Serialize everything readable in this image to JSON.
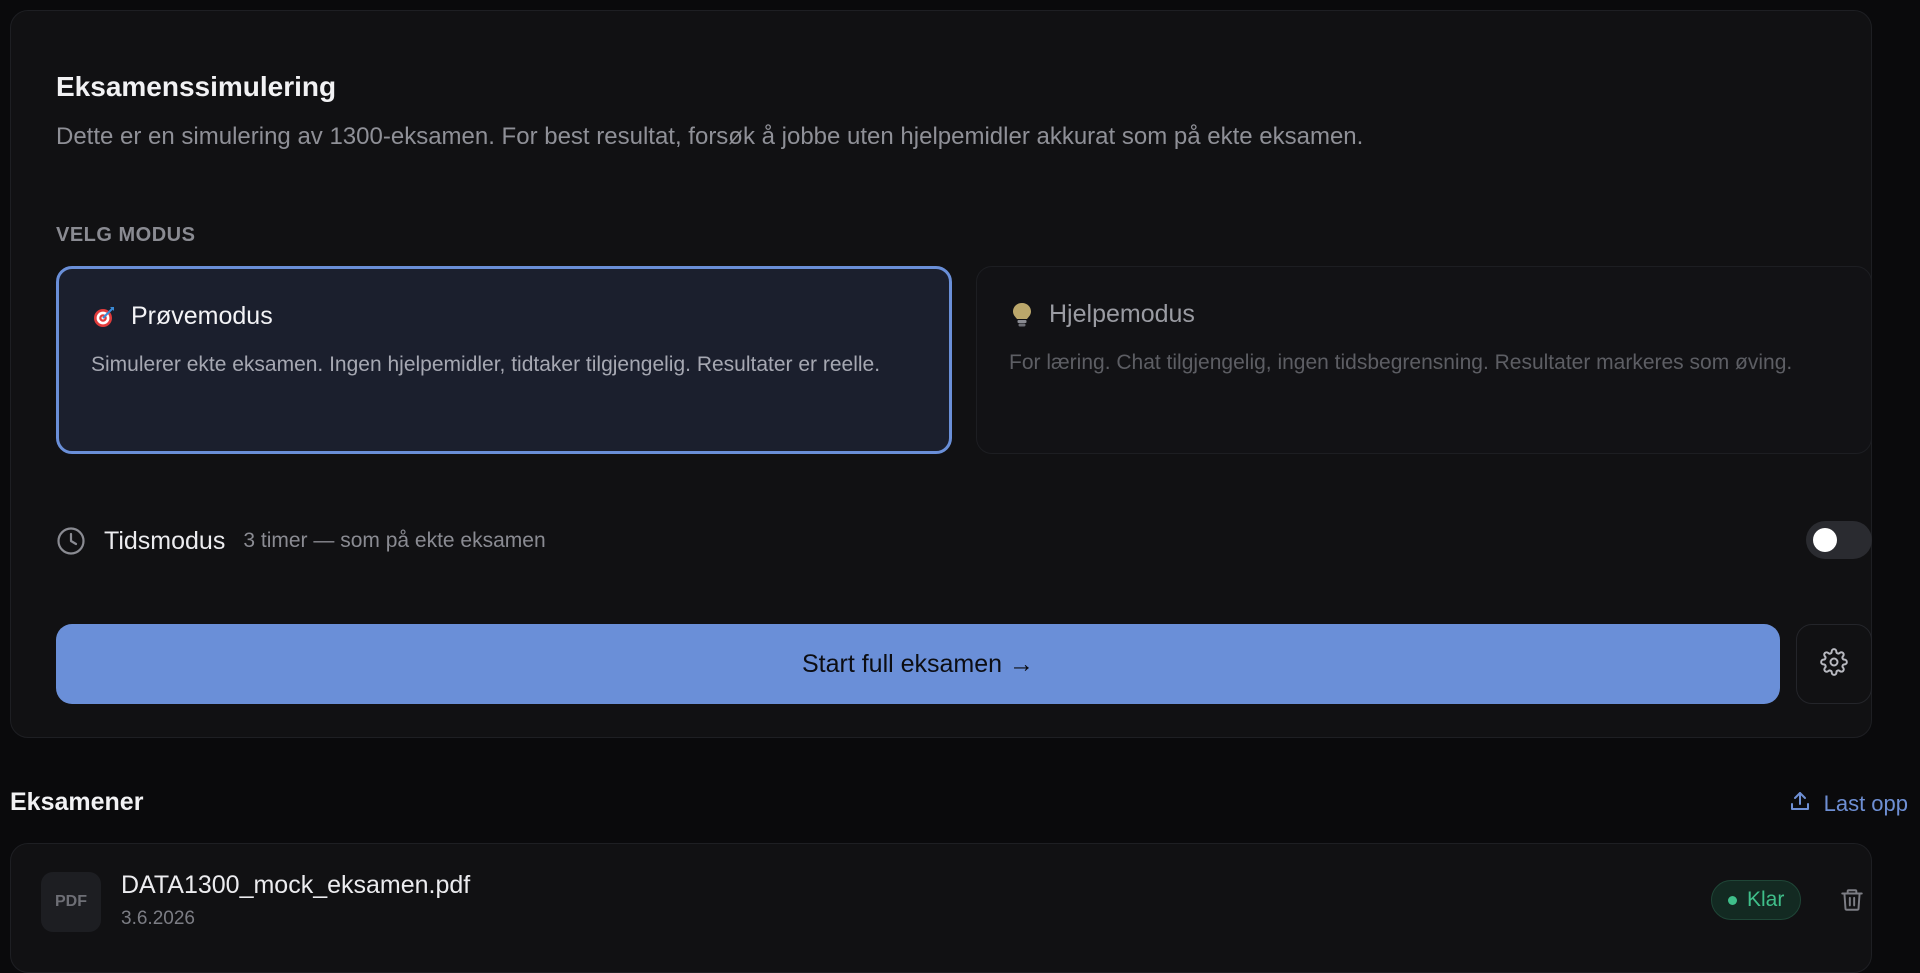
{
  "exam_sim": {
    "title": "Eksamenssimulering",
    "subtitle": "Dette er en simulering av 1300-eksamen. For best resultat, forsøk å jobbe uten hjelpemidler akkurat som på ekte eksamen.",
    "mode_label": "VELG MODUS",
    "modes": [
      {
        "icon": "target-icon",
        "title": "Prøvemodus",
        "description": "Simulerer ekte eksamen. Ingen hjelpemidler, tidtaker tilgjengelig. Resultater er reelle.",
        "selected": true
      },
      {
        "icon": "lightbulb-icon",
        "title": "Hjelpemodus",
        "description": "For læring. Chat tilgjengelig, ingen tidsbegrensning. Resultater markeres som øving.",
        "selected": false
      }
    ],
    "time_mode": {
      "icon": "clock-icon",
      "label": "Tidsmodus",
      "description": "3 timer — som på ekte eksamen",
      "enabled": false
    },
    "start_button": "Start full eksamen →",
    "settings_icon": "gear-icon"
  },
  "exams": {
    "title": "Eksamener",
    "upload_label": "Last opp",
    "upload_icon": "upload-icon",
    "files": [
      {
        "type_label": "PDF",
        "name": "DATA1300_mock_eksamen.pdf",
        "date": "3.6.2026",
        "status": "Klar",
        "delete_icon": "trash-icon"
      }
    ]
  },
  "colors": {
    "accent": "#6a8fd8",
    "status_ready": "#3fbf8a",
    "background": "#0a0a0c",
    "card": "#111113"
  }
}
